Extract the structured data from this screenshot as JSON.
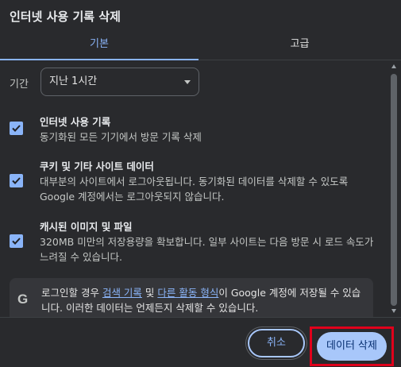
{
  "dialog": {
    "title": "인터넷 사용 기록 삭제"
  },
  "tabs": [
    {
      "label": "기본",
      "selected": true
    },
    {
      "label": "고급",
      "selected": false
    }
  ],
  "time_range": {
    "label": "기간",
    "value": "지난 1시간"
  },
  "options": [
    {
      "title": "인터넷 사용 기록",
      "description": "동기화된 모든 기기에서 방문 기록 삭제",
      "checked": true
    },
    {
      "title": "쿠키 및 기타 사이트 데이터",
      "description": "대부분의 사이트에서 로그아웃됩니다. 동기화된 데이터를 삭제할 수 있도록 Google 계정에서는 로그아웃되지 않습니다.",
      "checked": true
    },
    {
      "title": "캐시된 이미지 및 파일",
      "description": "320MB 미만의 저장용량을 확보합니다. 일부 사이트는 다음 방문 시 로드 속도가 느려질 수 있습니다.",
      "checked": true
    }
  ],
  "info": {
    "icon": "google-g-icon",
    "text_before": "로그인할 경우 ",
    "link1": "검색 기록",
    "text_mid": " 및 ",
    "link2": "다른 활동 형식",
    "text_after": "이 Google 계정에 저장될 수 있습니다. 이러한 데이터는 언제든지 삭제할 수 있습니다."
  },
  "buttons": {
    "cancel": "취소",
    "delete": "데이터 삭제"
  },
  "colors": {
    "accent": "#8ab4f8",
    "primary_button": "#a8c7fa",
    "highlight_border": "#e0001b"
  }
}
